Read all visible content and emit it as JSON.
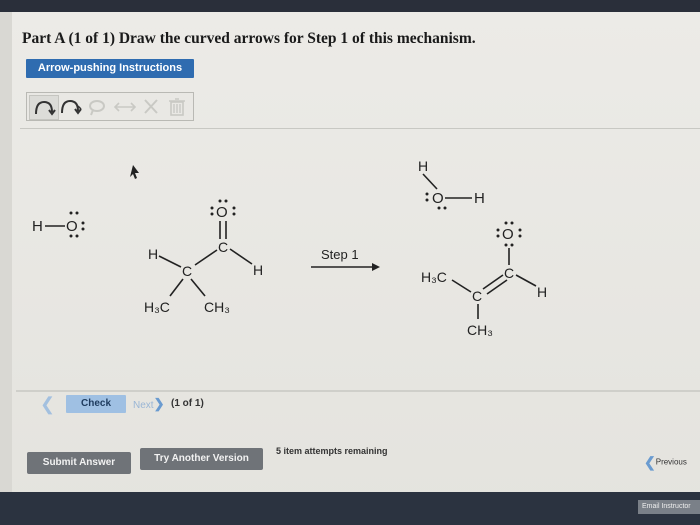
{
  "header": {
    "part_title": "Part A (1 of 1) Draw the curved arrows for Step 1 of this mechanism.",
    "instructions_label": "Arrow-pushing Instructions"
  },
  "toolbar": {
    "tools": [
      {
        "name": "single-curved-arrow-icon",
        "active": true
      },
      {
        "name": "double-curved-arrow-icon",
        "active": false
      },
      {
        "name": "lasso-select-icon",
        "active": false
      },
      {
        "name": "resonance-arrow-icon",
        "active": false
      },
      {
        "name": "delete-x-icon",
        "active": false
      },
      {
        "name": "trash-icon",
        "active": false
      }
    ]
  },
  "mechanism": {
    "hydroxide": {
      "h": "H",
      "o": "O"
    },
    "reactant": {
      "o": "O",
      "c_carbonyl": "C",
      "c_alpha": "C",
      "h_left": "H",
      "h_right": "H",
      "methyl_left": "H₃C",
      "methyl_right": "CH₃"
    },
    "step_label": "Step 1",
    "water": {
      "h_top": "H",
      "o": "O",
      "h_right": "H"
    },
    "product": {
      "o": "O",
      "c_carbonyl": "C",
      "c_alpha": "C",
      "h_right": "H",
      "methyl_left": "H₃C",
      "methyl_bottom": "CH₃"
    }
  },
  "controls": {
    "check_label": "Check",
    "next_label": "Next",
    "progress_label": "(1 of 1)",
    "submit_label": "Submit Answer",
    "try_another_label": "Try Another Version",
    "attempts_label": "5 item attempts remaining",
    "previous_label": "Previous",
    "email_label": "Email Instructor"
  },
  "colors": {
    "accent_blue": "#2f6cb0",
    "check_blue": "#9fc0e3",
    "button_gray": "#6f7378"
  }
}
